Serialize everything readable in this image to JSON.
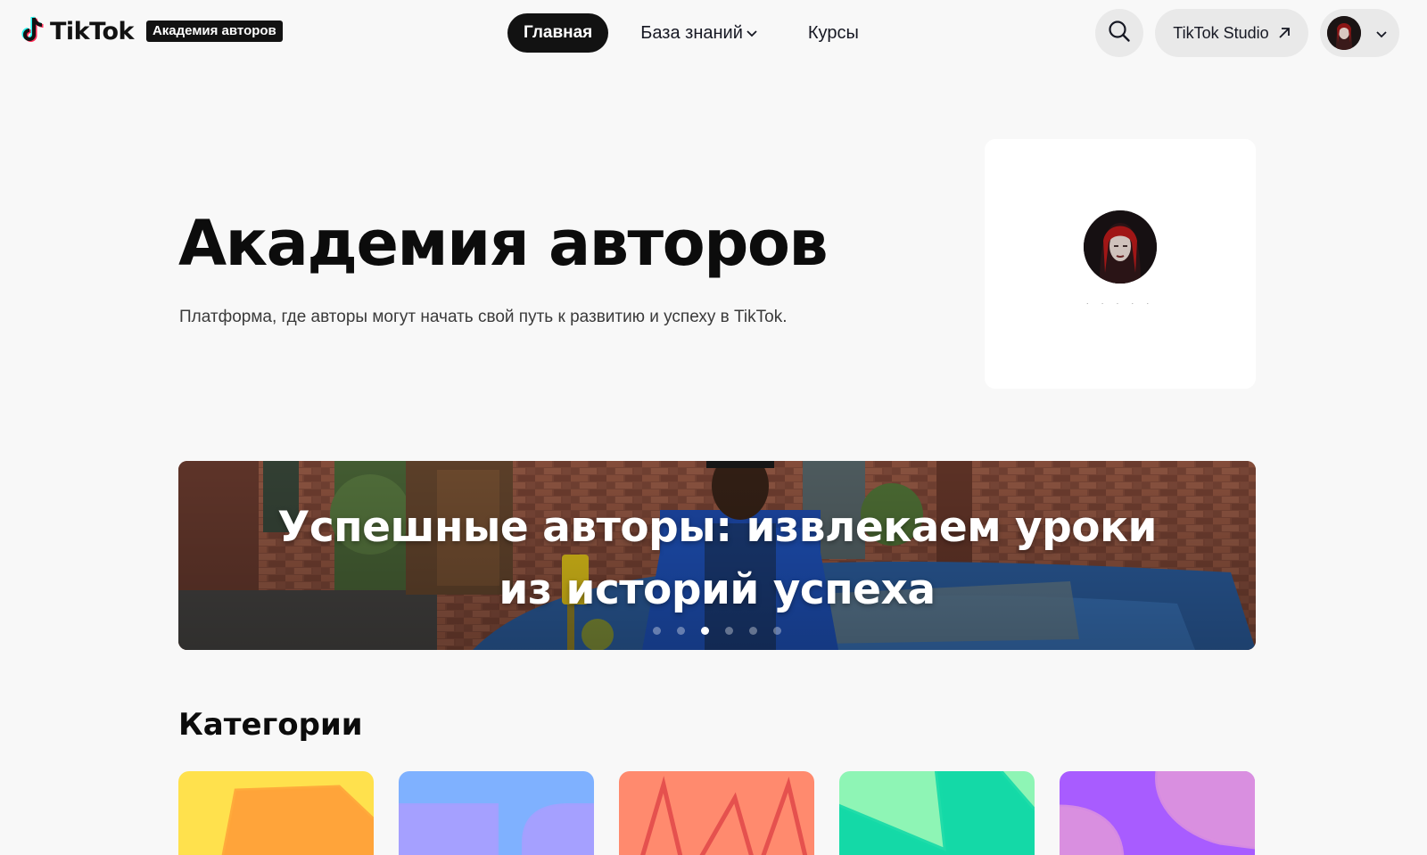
{
  "header": {
    "logo_text": "TikTok",
    "logo_badge": "Академия авторов",
    "nav": {
      "home": "Главная",
      "knowledge": "База знаний",
      "courses": "Курсы"
    },
    "search_icon": "search-icon",
    "studio_label": "TikTok Studio",
    "studio_icon": "arrow-up-right-icon",
    "account_icon": "chevron-down-icon"
  },
  "hero": {
    "title": "Академия авторов",
    "subtitle": "Платформа, где авторы могут начать свой путь к развитию и успеху в TikTok."
  },
  "profile_card": {
    "name": "· · · · ·"
  },
  "banner": {
    "title_line1": "Успешные авторы: извлекаем уроки",
    "title_line2": "из историй успеха",
    "slide_count": 6,
    "active_slide": 3
  },
  "categories": {
    "heading": "Категории",
    "cards": [
      {
        "color": "#ffe14d",
        "accent": "#ffa43a"
      },
      {
        "color": "#7fb1ff",
        "accent": "#a5a0ff"
      },
      {
        "color": "#ff8a6e",
        "accent": "#e24a4a"
      },
      {
        "color": "#8ef5b5",
        "accent": "#14d9a7"
      },
      {
        "color": "#a85cff",
        "accent": "#d98fe0"
      }
    ]
  }
}
